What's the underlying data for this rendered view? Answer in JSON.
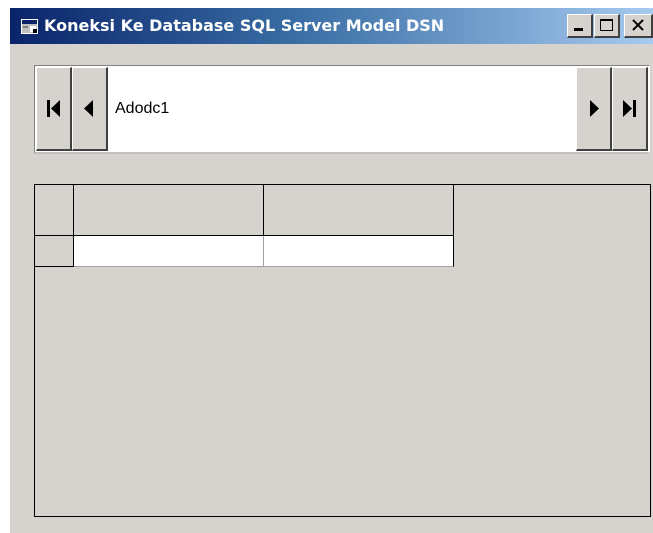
{
  "window": {
    "title": "Koneksi Ke Database SQL Server Model DSN",
    "icon": "form-icon",
    "caption_buttons": [
      "minimize",
      "maximize",
      "close"
    ]
  },
  "adodc": {
    "caption": "Adodc1",
    "buttons": [
      "move-first",
      "move-previous",
      "move-next",
      "move-last"
    ]
  },
  "grid": {
    "columns": [
      "",
      ""
    ],
    "rows": [
      [
        "",
        ""
      ]
    ]
  }
}
